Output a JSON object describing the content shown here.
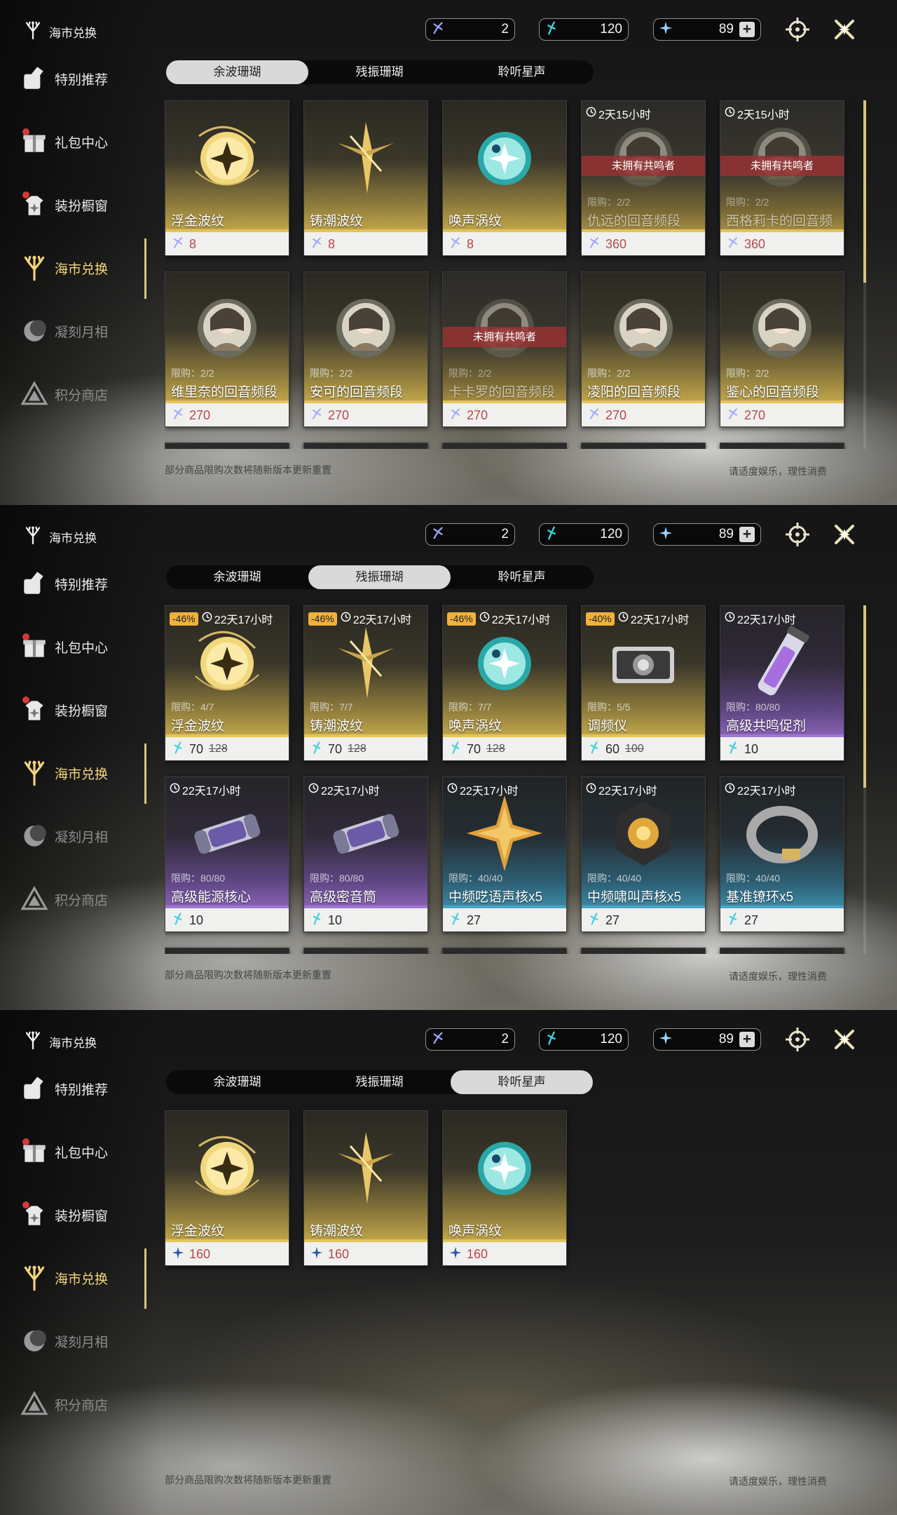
{
  "title": "海市兑换",
  "currencies": [
    {
      "icon": "coral-wave-icon",
      "value": "2"
    },
    {
      "icon": "coral-echo-icon",
      "value": "120"
    },
    {
      "icon": "star-sound-icon",
      "value": "89"
    }
  ],
  "plus_label": "+",
  "sidebar": [
    {
      "label": "特别推荐",
      "icon": "special-recommend-icon"
    },
    {
      "label": "礼包中心",
      "icon": "gift-icon"
    },
    {
      "label": "装扮橱窗",
      "icon": "outfit-icon"
    },
    {
      "label": "海市兑换",
      "icon": "coral-icon"
    },
    {
      "label": "凝刻月相",
      "icon": "moon-icon"
    },
    {
      "label": "积分商店",
      "icon": "points-icon"
    }
  ],
  "tabs": [
    "余波珊瑚",
    "残振珊瑚",
    "聆听星声"
  ],
  "footer_left": "部分商品限购次数将随新版本更新重置",
  "footer_right": "请适度娱乐，理性消费",
  "panels": [
    {
      "active_tab": 0,
      "items": [
        {
          "name": "浮金波纹",
          "price": "8",
          "style": "gold",
          "obj": "orb-gold"
        },
        {
          "name": "铸潮波纹",
          "price": "8",
          "style": "gold",
          "obj": "blade"
        },
        {
          "name": "唤声涡纹",
          "price": "8",
          "style": "gold",
          "obj": "orb-cyan"
        },
        {
          "name": "仇远的回音频段",
          "price": "360",
          "style": "dark",
          "obj": "portrait",
          "timer": "2天15小时",
          "limit": "限购：2/2",
          "banner": "未拥有共鸣者"
        },
        {
          "name": "西格莉卡的回音频段",
          "price": "360",
          "style": "dark",
          "obj": "portrait",
          "timer": "2天15小时",
          "limit": "限购：2/2",
          "banner": "未拥有共鸣者"
        },
        {
          "name": "维里奈的回音频段",
          "price": "270",
          "style": "gold",
          "obj": "portrait",
          "limit": "限购：2/2"
        },
        {
          "name": "安可的回音频段",
          "price": "270",
          "style": "gold",
          "obj": "portrait",
          "limit": "限购：2/2"
        },
        {
          "name": "卡卡罗的回音频段",
          "price": "270",
          "style": "dark",
          "obj": "portrait",
          "limit": "限购：2/2",
          "banner": "未拥有共鸣者"
        },
        {
          "name": "凌阳的回音频段",
          "price": "270",
          "style": "gold",
          "obj": "portrait",
          "limit": "限购：2/2"
        },
        {
          "name": "鉴心的回音频段",
          "price": "270",
          "style": "gold",
          "obj": "portrait",
          "limit": "限购：2/2"
        }
      ]
    },
    {
      "active_tab": 1,
      "items": [
        {
          "name": "浮金波纹",
          "price": "70",
          "old": "128",
          "discount": "-46%",
          "timer": "22天17小时",
          "limit": "限购：4/7",
          "style": "gold",
          "obj": "orb-gold"
        },
        {
          "name": "铸潮波纹",
          "price": "70",
          "old": "128",
          "discount": "-46%",
          "timer": "22天17小时",
          "limit": "限购：7/7",
          "style": "gold",
          "obj": "blade"
        },
        {
          "name": "唤声涡纹",
          "price": "70",
          "old": "128",
          "discount": "-46%",
          "timer": "22天17小时",
          "limit": "限购：7/7",
          "style": "gold",
          "obj": "orb-cyan"
        },
        {
          "name": "调频仪",
          "price": "60",
          "old": "100",
          "discount": "-40%",
          "timer": "22天17小时",
          "limit": "限购：5/5",
          "style": "gold",
          "obj": "device"
        },
        {
          "name": "高级共鸣促剂",
          "price": "10",
          "timer": "22天17小时",
          "limit": "限购：80/80",
          "style": "purple",
          "obj": "vial"
        },
        {
          "name": "高级能源核心",
          "price": "10",
          "timer": "22天17小时",
          "limit": "限购：80/80",
          "style": "purple",
          "obj": "capsule"
        },
        {
          "name": "高级密音筒",
          "price": "10",
          "timer": "22天17小时",
          "limit": "限购：80/80",
          "style": "purple",
          "obj": "capsule"
        },
        {
          "name": "中频呓语声核x5",
          "price": "27",
          "timer": "22天17小时",
          "limit": "限购：40/40",
          "style": "blue",
          "obj": "star"
        },
        {
          "name": "中频啸叫声核x5",
          "price": "27",
          "timer": "22天17小时",
          "limit": "限购：40/40",
          "style": "blue",
          "obj": "core"
        },
        {
          "name": "基准镣环x5",
          "price": "27",
          "timer": "22天17小时",
          "limit": "限购：40/40",
          "style": "blue",
          "obj": "ring"
        }
      ]
    },
    {
      "active_tab": 2,
      "items": [
        {
          "name": "浮金波纹",
          "price": "160",
          "style": "gold",
          "obj": "orb-gold"
        },
        {
          "name": "铸潮波纹",
          "price": "160",
          "style": "gold",
          "obj": "blade"
        },
        {
          "name": "唤声涡纹",
          "price": "160",
          "style": "gold",
          "obj": "orb-cyan"
        }
      ]
    }
  ],
  "colors": {
    "accent": "#f3d57a",
    "price_red": "#b44a4a",
    "banner": "#963232",
    "discount": "#f0b23c"
  }
}
